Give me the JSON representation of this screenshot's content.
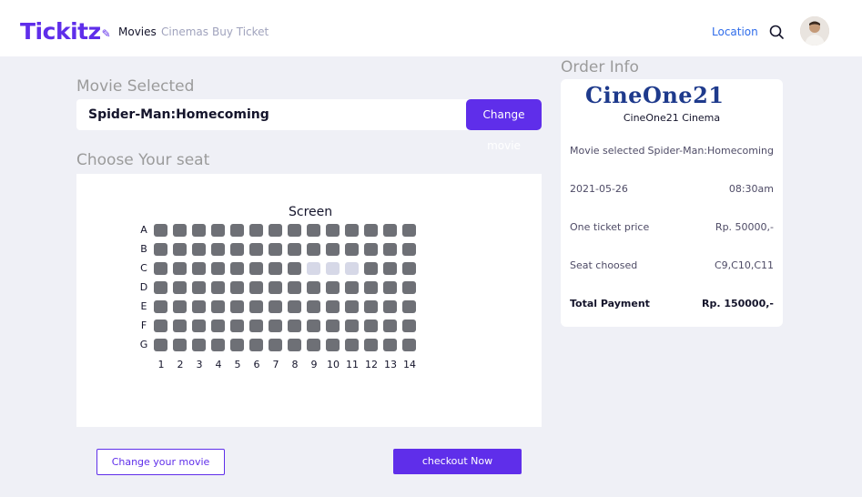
{
  "nav": {
    "logo": "Tickitz",
    "logo_mark": "✎",
    "links": [
      "Movies",
      "Cinemas",
      "Buy Ticket"
    ],
    "active_link": "Movies",
    "location": "Location",
    "search_icon": "search-icon",
    "avatar_icon": "user-avatar"
  },
  "movie_selected": {
    "title": "Movie Selected",
    "movie_name": "Spider-Man:Homecoming",
    "change_button": "Change movie"
  },
  "seats": {
    "title": "Choose Your seat",
    "screen_label": "Screen",
    "rows": [
      "A",
      "B",
      "C",
      "D",
      "E",
      "F",
      "G"
    ],
    "columns": [
      "1",
      "2",
      "3",
      "4",
      "5",
      "6",
      "7",
      "8",
      "9",
      "10",
      "11",
      "12",
      "13",
      "14"
    ],
    "selected": [
      "C9",
      "C10",
      "C11"
    ],
    "colors": {
      "available": "#6e7076",
      "selected": "#d6d8e7"
    }
  },
  "order_info": {
    "title": "Order Info",
    "cinema_logo": "CineOne21",
    "cinema_name": "CineOne21 Cinema",
    "rows": [
      {
        "label": "Movie selected",
        "value": "Spider-Man:Homecoming"
      },
      {
        "label": "2021-05-26",
        "value": "08:30am"
      },
      {
        "label": "One ticket price",
        "value": "Rp. 50000,-"
      },
      {
        "label": "Seat choosed",
        "value": "C9,C10,C11"
      }
    ],
    "total_label": "Total Payment",
    "total_value": "Rp. 150000,-"
  },
  "actions": {
    "change_your_movie": "Change your movie",
    "checkout": "checkout Now"
  },
  "colors": {
    "primary": "#5f2eea",
    "link": "#2f6cea",
    "background": "#eff0f6"
  }
}
